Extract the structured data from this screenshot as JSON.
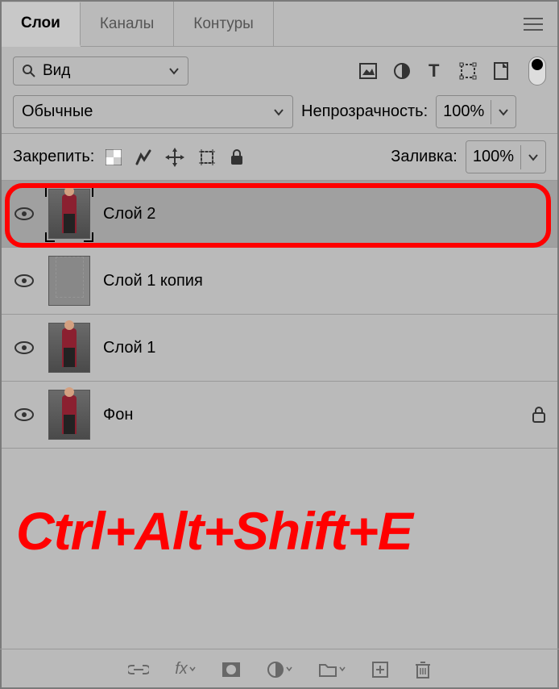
{
  "tabs": {
    "layers": "Слои",
    "channels": "Каналы",
    "paths": "Контуры"
  },
  "filter": {
    "label": "Вид"
  },
  "blend_mode": "Обычные",
  "opacity": {
    "label": "Непрозрачность:",
    "value": "100%"
  },
  "lock": {
    "label": "Закрепить:"
  },
  "fill": {
    "label": "Заливка:",
    "value": "100%"
  },
  "layers_list": [
    {
      "name": "Слой 2",
      "selected": true,
      "thumb": "photo",
      "locked": false
    },
    {
      "name": "Слой 1 копия",
      "selected": false,
      "thumb": "white",
      "locked": false
    },
    {
      "name": "Слой 1",
      "selected": false,
      "thumb": "photo",
      "locked": false
    },
    {
      "name": "Фон",
      "selected": false,
      "thumb": "photo",
      "locked": true
    }
  ],
  "shortcut": "Ctrl+Alt+Shift+E"
}
